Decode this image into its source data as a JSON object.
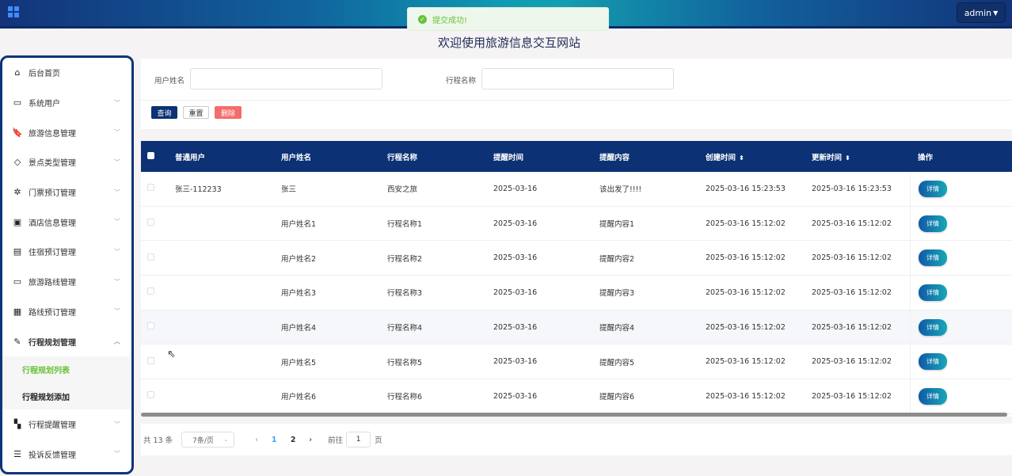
{
  "header": {
    "admin_label": "admin",
    "welcome": "欢迎使用旅游信息交互网站"
  },
  "toast": {
    "message": "提交成功!"
  },
  "sidebar": {
    "items": [
      {
        "label": "后台首页",
        "icon": "home-icon",
        "glyph": "⌂",
        "has_arrow": false
      },
      {
        "label": "系统用户",
        "icon": "laptop-icon",
        "glyph": "▭",
        "has_arrow": true
      },
      {
        "label": "旅游信息管理",
        "icon": "bookmark-icon",
        "glyph": "🔖",
        "has_arrow": true
      },
      {
        "label": "景点类型管理",
        "icon": "tag-icon",
        "glyph": "◇",
        "has_arrow": true
      },
      {
        "label": "门票预订管理",
        "icon": "sun-icon",
        "glyph": "✲",
        "has_arrow": true
      },
      {
        "label": "酒店信息管理",
        "icon": "inbox-icon",
        "glyph": "▣",
        "has_arrow": true
      },
      {
        "label": "住宿预订管理",
        "icon": "clipboard-icon",
        "glyph": "▤",
        "has_arrow": true
      },
      {
        "label": "旅游路线管理",
        "icon": "chat-icon",
        "glyph": "▭",
        "has_arrow": true
      },
      {
        "label": "路线预订管理",
        "icon": "box-icon",
        "glyph": "▦",
        "has_arrow": true
      },
      {
        "label": "行程规划管理",
        "icon": "paperclip-icon",
        "glyph": "✎",
        "has_arrow": true,
        "expanded": true
      }
    ],
    "subitems": [
      {
        "label": "行程规划列表",
        "current": true
      },
      {
        "label": "行程规划添加",
        "current": false
      }
    ],
    "items_after": [
      {
        "label": "行程提醒管理",
        "icon": "copy-icon",
        "glyph": "▚",
        "has_arrow": true
      },
      {
        "label": "投诉反馈管理",
        "icon": "sliders-icon",
        "glyph": "☰",
        "has_arrow": true
      }
    ]
  },
  "search": {
    "username_label": "用户姓名",
    "username_value": "",
    "trip_label": "行程名称",
    "trip_value": "",
    "query_label": "查询",
    "reset_label": "重置",
    "delete_label": "删除"
  },
  "table": {
    "columns": [
      "普通用户",
      "用户姓名",
      "行程名称",
      "提醒时间",
      "提醒内容",
      "创建时间",
      "更新时间",
      "操作"
    ],
    "detail_label": "详情",
    "rows": [
      [
        "张三-112233",
        "张三",
        "西安之旅",
        "2025-03-16",
        "该出发了!!!!",
        "2025-03-16 15:23:53",
        "2025-03-16 15:23:53"
      ],
      [
        "",
        "用户姓名1",
        "行程名称1",
        "2025-03-16",
        "提醒内容1",
        "2025-03-16 15:12:02",
        "2025-03-16 15:12:02"
      ],
      [
        "",
        "用户姓名2",
        "行程名称2",
        "2025-03-16",
        "提醒内容2",
        "2025-03-16 15:12:02",
        "2025-03-16 15:12:02"
      ],
      [
        "",
        "用户姓名3",
        "行程名称3",
        "2025-03-16",
        "提醒内容3",
        "2025-03-16 15:12:02",
        "2025-03-16 15:12:02"
      ],
      [
        "",
        "用户姓名4",
        "行程名称4",
        "2025-03-16",
        "提醒内容4",
        "2025-03-16 15:12:02",
        "2025-03-16 15:12:02"
      ],
      [
        "",
        "用户姓名5",
        "行程名称5",
        "2025-03-16",
        "提醒内容5",
        "2025-03-16 15:12:02",
        "2025-03-16 15:12:02"
      ],
      [
        "",
        "用户姓名6",
        "行程名称6",
        "2025-03-16",
        "提醒内容6",
        "2025-03-16 15:12:02",
        "2025-03-16 15:12:02"
      ]
    ]
  },
  "pagination": {
    "total_label": "共 13 条",
    "page_size": "7条/页",
    "pages": [
      "1",
      "2"
    ],
    "current_page": "1",
    "goto_prefix": "前往",
    "goto_value": "1",
    "goto_suffix": "页"
  },
  "colors": {
    "primary": "#0c3174",
    "success": "#67c23a",
    "danger": "#f56c6c"
  }
}
